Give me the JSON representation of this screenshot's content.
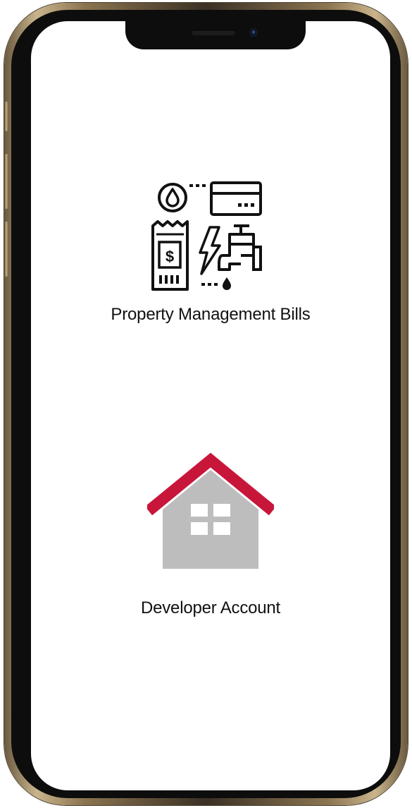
{
  "menu": {
    "items": [
      {
        "label": "Property Management Bills",
        "icon": "bills-utilities-icon"
      },
      {
        "label": "Developer Account",
        "icon": "house-icon"
      }
    ]
  },
  "colors": {
    "roof_red": "#c8163a",
    "house_grey": "#bdbdbd",
    "icon_black": "#111111",
    "frame_gold": "#c9b48c"
  }
}
